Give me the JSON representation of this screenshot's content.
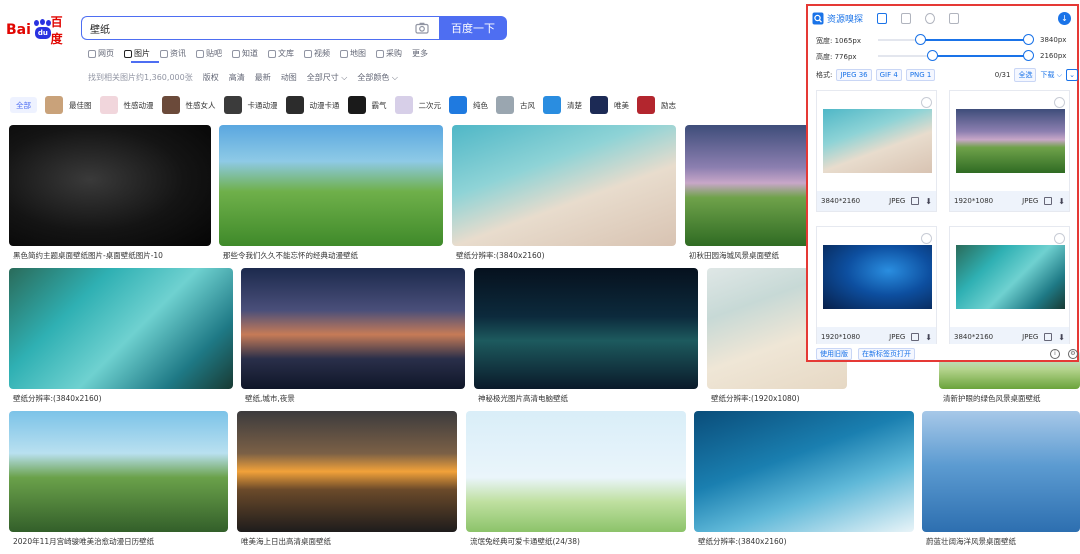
{
  "brand": {
    "logo_bai": "Bai",
    "logo_du": "du",
    "logo_text": "百度"
  },
  "search": {
    "value": "壁纸",
    "button_label": "百度一下"
  },
  "nav": {
    "tabs": [
      {
        "label": "网页"
      },
      {
        "label": "图片"
      },
      {
        "label": "资讯"
      },
      {
        "label": "贴吧"
      },
      {
        "label": "知道"
      },
      {
        "label": "文库"
      },
      {
        "label": "视频"
      },
      {
        "label": "地图"
      },
      {
        "label": "采购"
      },
      {
        "label": "更多"
      }
    ],
    "active_index": 1
  },
  "filters": {
    "result_count": "找到相关图片约1,360,000张",
    "items": [
      "版权",
      "高清",
      "最新",
      "动图",
      "全部尺寸 ⌵",
      "全部颜色 ⌵"
    ]
  },
  "tags": [
    {
      "label": "全部",
      "color": "#eef2ff"
    },
    {
      "label": "最佳图",
      "color": "#c9a27a"
    },
    {
      "label": "性感动漫",
      "color": "#f1d6dc"
    },
    {
      "label": "性感女人",
      "color": "#6b4a3a"
    },
    {
      "label": "卡通动漫",
      "color": "#3b3b3b"
    },
    {
      "label": "动漫卡通",
      "color": "#2c2c2c"
    },
    {
      "label": "霸气",
      "color": "#1a1a1a"
    },
    {
      "label": "二次元",
      "color": "#d7cfe8"
    },
    {
      "label": "纯色",
      "color": "#1f7ae0"
    },
    {
      "label": "古风",
      "color": "#9aa6b0"
    },
    {
      "label": "清楚",
      "color": "#2a8de0"
    },
    {
      "label": "唯美",
      "color": "#1c2a55"
    },
    {
      "label": "励志",
      "color": "#b3262e"
    }
  ],
  "images": [
    {
      "caption": "黑色简约主题桌面壁纸图片-桌面壁纸图片-10",
      "bg": "radial-gradient(ellipse at 40% 45%, #3a3a3a 0%, #141414 55%, #050505 100%)"
    },
    {
      "caption": "那些令我们久久不能忘怀的经典动漫壁纸",
      "bg": "linear-gradient(180deg, #5aa7e0 0%, #8ecae6 30%, #6fb04a 55%, #3f8a2a 100%)"
    },
    {
      "caption": "壁纸分辨率:(3840x2160)",
      "bg": "linear-gradient(160deg, #4fb7c7 0%, #8ed3d6 35%, #e8dccd 60%, #d8c3b2 100%)"
    },
    {
      "caption": "初秋田园海城风景桌面壁纸",
      "bg": "linear-gradient(180deg, #3e4d7a 0%, #8c7fb0 35%, #c8a7c8 48%, #6fa24a 60%, #2f6b23 100%)"
    },
    {
      "caption": "壁纸分辨率:(3840x2160)",
      "bg": "linear-gradient(135deg, #2a6b5a 0%, #2fb0b3 30%, #6fd1d0 55%, #1f7a86 80%, #183a33 100%)"
    },
    {
      "caption": "壁纸,城市,夜景",
      "bg": "linear-gradient(180deg, #1c2a4d 0%, #4a4f7a 35%, #c67b57 55%, #2a2f4a 75%, #0f1628 100%)"
    },
    {
      "caption": "神秘极光图片高清电脑壁纸",
      "bg": "linear-gradient(180deg, #06111e 0%, #0c2a3c 40%, #1d5a5e 60%, #0a1a2a 100%)"
    },
    {
      "caption": "壁纸分辨率:(1920x1080)",
      "bg": "linear-gradient(160deg, #dfe7e6 0%, #c7d9d6 30%, #efe6d6 60%, #e6d8c4 100%)"
    },
    {
      "caption": "清新护眼的绿色风景桌面壁纸",
      "bg": "linear-gradient(180deg, #cfe3f5 0%, #b4d38c 50%, #6aa33b 100%)"
    },
    {
      "caption": "2020年11月宫崎骏唯美治愈动漫日历壁纸",
      "bg": "linear-gradient(180deg, #7cc3e8 0%, #b9e0f0 35%, #6aa14a 55%, #335f2a 100%)"
    },
    {
      "caption": "唯美海上日出高清桌面壁纸",
      "bg": "linear-gradient(180deg, #3c3b3d 0%, #7b6046 35%, #f2a23a 50%, #6b4a2a 65%, #1e1c1c 100%)"
    },
    {
      "caption": "流氓兔经典可爱卡通壁纸(24/38)",
      "bg": "linear-gradient(180deg, #d9eef8 0%, #eaf5fb 55%, #bfe0a0 75%, #8cc36a 100%)"
    },
    {
      "caption": "壁纸分辨率:(3840x2160)",
      "bg": "linear-gradient(160deg, #0a4d7a 0%, #1a7fb0 40%, #5fb8d8 65%, #e9f4f8 100%)"
    },
    {
      "caption": "蔚蓝壮阔海洋风景桌面壁纸",
      "bg": "linear-gradient(180deg, #a7c8e8 0%, #5c9bd1 45%, #2d6fb0 100%)"
    }
  ],
  "panel": {
    "title": "资源嗅探",
    "width": {
      "label": "宽度:",
      "min": "1065px",
      "max": "3840px",
      "min_frac": 0.28,
      "max_frac": 1.0
    },
    "height": {
      "label": "高度:",
      "min": "776px",
      "max": "2160px",
      "min_frac": 0.36,
      "max_frac": 1.0
    },
    "format_label": "格式:",
    "formats": [
      "JPEG 36",
      "GIF 4",
      "PNG 1"
    ],
    "selected_count": "0/31",
    "select_all": "全选",
    "download": "下载 ⌵",
    "results": [
      {
        "size": "3840*2160",
        "format": "JPEG",
        "bg": "linear-gradient(160deg, #4fb7c7 0%, #8ed3d6 35%, #e8dccd 60%, #d8c3b2 100%)"
      },
      {
        "size": "1920*1080",
        "format": "JPEG",
        "bg": "linear-gradient(180deg, #3e4d7a 0%, #8c7fb0 35%, #c8a7c8 48%, #6fa24a 60%, #2f6b23 100%)"
      },
      {
        "size": "1920*1080",
        "format": "JPEG",
        "bg": "radial-gradient(ellipse at 60% 40%, #2a8ee0 0%, #0d4fa0 45%, #07204a 100%)"
      },
      {
        "size": "3840*2160",
        "format": "JPEG",
        "bg": "linear-gradient(135deg, #2a6b5a 0%, #2fb0b3 30%, #6fd1d0 55%, #1f7a86 80%, #183a33 100%)"
      }
    ],
    "footer_buttons": [
      "使用旧版",
      "在新标签页打开"
    ],
    "accent": "#1a73e8",
    "frame_color": "#e53935"
  }
}
